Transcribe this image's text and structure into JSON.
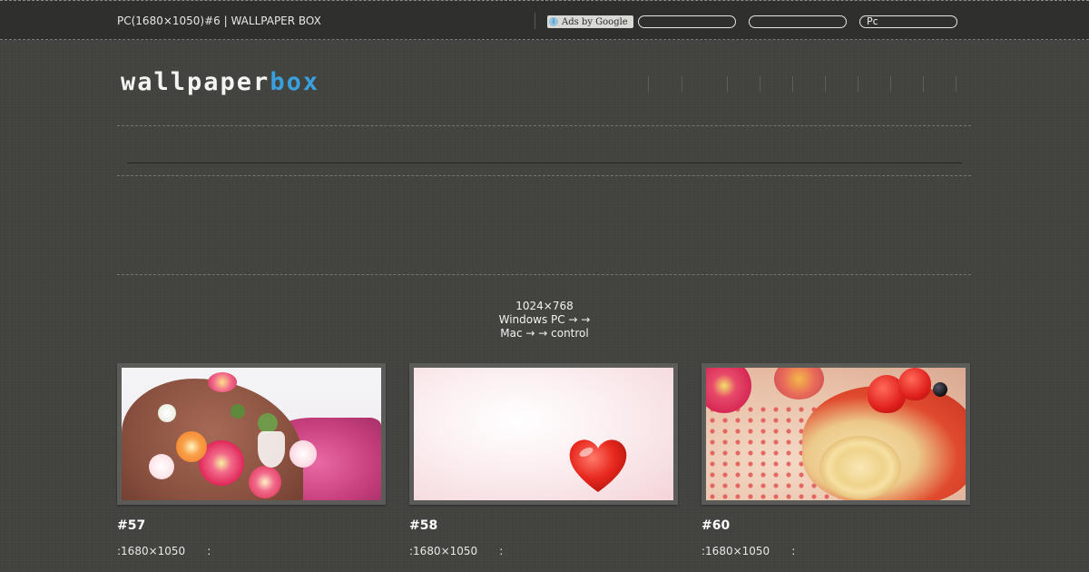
{
  "topbar": {
    "title": "PC(1680×1050)#6 | WALLPAPER BOX",
    "ads_label": "Ads by Google",
    "links": [
      "",
      "",
      "Pc"
    ]
  },
  "header": {
    "logo_main": "wallpaper",
    "logo_accent": "box",
    "accent_color": "#3aa0dd"
  },
  "info": {
    "line1": "1024×768",
    "line2": "Windows PC → →",
    "line3": "Mac → → control"
  },
  "cards": [
    {
      "number": "#57",
      "resolution": ":1680×1050",
      "meta_suffix": ":",
      "thumb": "flower-cake"
    },
    {
      "number": "#58",
      "resolution": ":1680×1050",
      "meta_suffix": ":",
      "thumb": "heart-candy"
    },
    {
      "number": "#60",
      "resolution": ":1680×1050",
      "meta_suffix": ":",
      "thumb": "strawberry-roll-cake"
    }
  ],
  "icons": {
    "ads_info": "info-icon"
  }
}
